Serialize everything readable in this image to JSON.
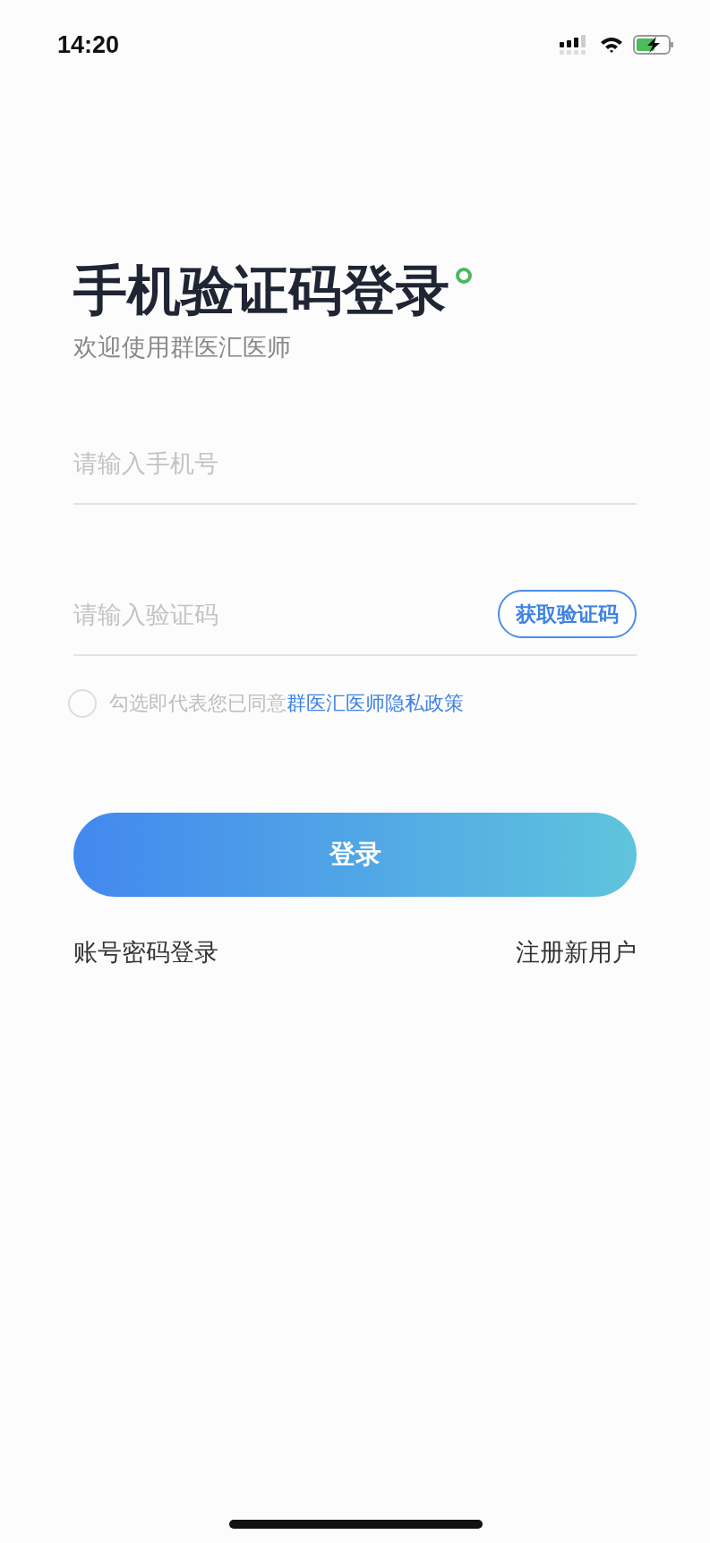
{
  "status_bar": {
    "time": "14:20"
  },
  "title": "手机验证码登录",
  "subtitle": "欢迎使用群医汇医师",
  "phone_field": {
    "placeholder": "请输入手机号"
  },
  "code_field": {
    "placeholder": "请输入验证码",
    "button": "获取验证码"
  },
  "agreement": {
    "checked": false,
    "text": "勾选即代表您已同意",
    "link": "群医汇医师隐私政策"
  },
  "login_button": "登录",
  "links": [
    {
      "label": "账号密码登录"
    },
    {
      "label": "注册新用户"
    }
  ]
}
